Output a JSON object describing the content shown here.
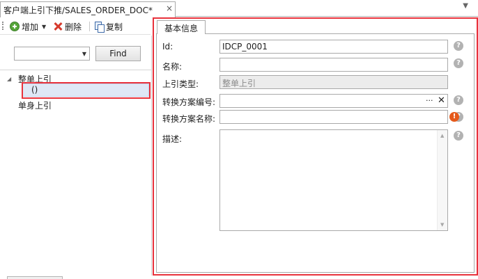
{
  "document_tab": {
    "title": "客户端上引下推/SALES_ORDER_DOC*",
    "close_glyph": "×",
    "menu_glyph": "▼"
  },
  "toolbar": {
    "add_label": "增加",
    "add_dropdown_glyph": "▼",
    "delete_label": "删除",
    "copy_label": "复制",
    "add_icon": "add-circle-icon",
    "delete_icon": "delete-x-icon",
    "copy_icon": "copy-icon"
  },
  "left_panel": {
    "search_select": {
      "value": "",
      "arrow_glyph": "▼"
    },
    "find_button": "Find",
    "tree": [
      {
        "label": "整单上引",
        "expanded": true,
        "expander_glyph": "◢"
      },
      {
        "label": "()",
        "selected": true
      },
      {
        "label": "单身上引"
      }
    ]
  },
  "form": {
    "tab_label": "基本信息",
    "fields": [
      {
        "label": "Id:",
        "value": "IDCP_0001",
        "help": "?"
      },
      {
        "label": "名称:",
        "value": "",
        "help": "?"
      },
      {
        "label": "上引类型:",
        "value": "整单上引",
        "readonly": true
      },
      {
        "label": "转换方案编号:",
        "value": "",
        "ellipsis": "···",
        "clear": "✕",
        "help": "?"
      },
      {
        "label": "转换方案名称:",
        "value": "",
        "error": "!",
        "help": "?"
      },
      {
        "label": "描述:",
        "value": "",
        "help": "?"
      }
    ]
  },
  "colors": {
    "highlight_border": "#e8323c",
    "selected_row": "#dfe8f6",
    "error_icon": "#e55a1c",
    "help_icon": "#b2b2b2"
  }
}
